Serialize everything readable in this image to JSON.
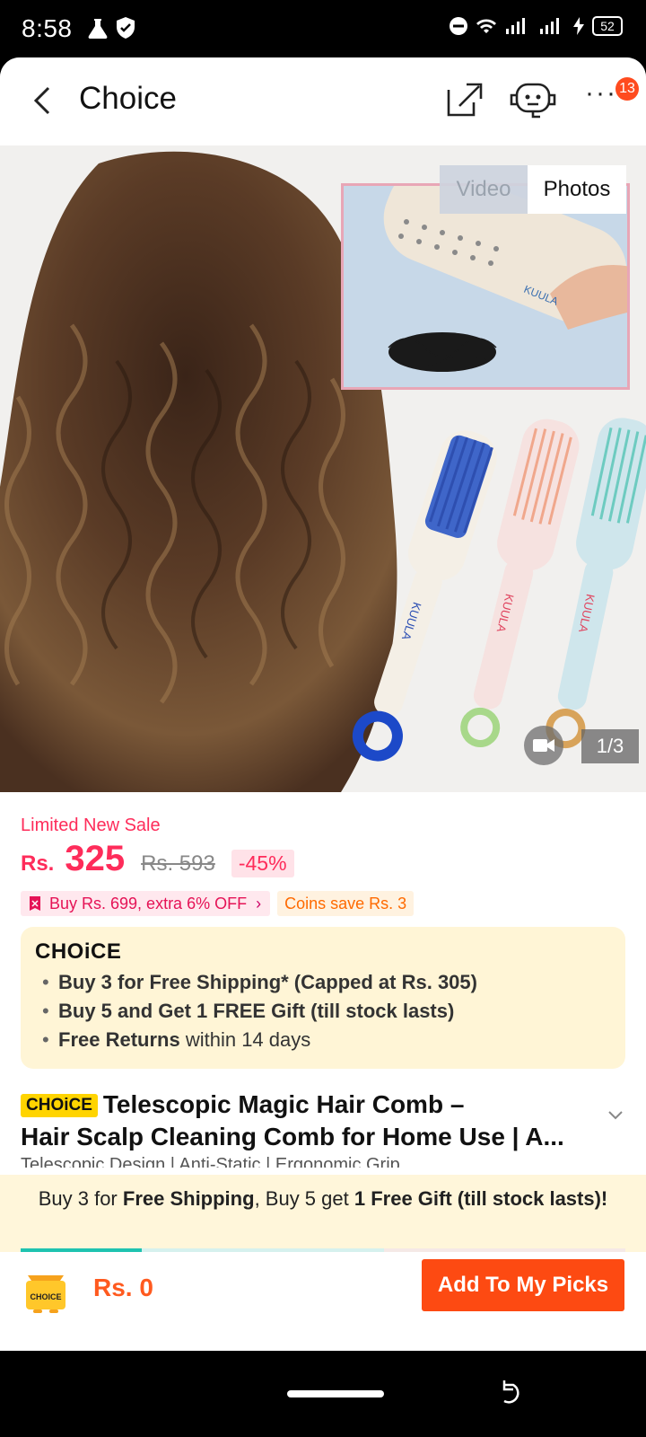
{
  "status_bar": {
    "time": "8:58",
    "battery": "52"
  },
  "header": {
    "title": "Choice",
    "notification_count": "13"
  },
  "gallery": {
    "tabs": [
      "Video",
      "Photos"
    ],
    "selected_tab": "Photos",
    "counter": "1/3",
    "brand_text": "KUULA"
  },
  "price": {
    "sale_label": "Limited New Sale",
    "currency": "Rs.",
    "current": "325",
    "original": "Rs. 593",
    "discount": "-45%"
  },
  "promos": {
    "coupon": "Buy Rs. 699, extra 6% OFF",
    "coins": "Coins save Rs. 3"
  },
  "choice_box": {
    "logo": "CHOiCE",
    "items": [
      {
        "bold": "Buy 3 for  Free Shipping* (Capped at Rs. 305)",
        "rest": ""
      },
      {
        "bold": "Buy 5 and Get 1 FREE Gift (till stock lasts)",
        "rest": ""
      },
      {
        "bold": "Free Returns",
        "rest": " within 14 days"
      }
    ]
  },
  "product": {
    "tag": "CHOiCE",
    "title_line1": "Telescopic Magic Hair Comb –",
    "title_line2": "Hair Scalp Cleaning Comb for Home Use | A...",
    "attributes": "Telescopic Design | Anti-Static | Ergonomic Grip"
  },
  "shipping_banner": {
    "p1": "Buy 3 for ",
    "b1": "Free Shipping",
    "p2": ", Buy 5 get ",
    "b2": "1 Free Gift (till stock lasts)!",
    "progress": 0.2
  },
  "bottom_bar": {
    "cart_label": "CHOICE",
    "amount": "Rs. 0",
    "add_button": "Add To My Picks"
  },
  "colors": {
    "accent_orange": "#fd4a12",
    "sale_red": "#fe2c5a",
    "choice_yellow": "#ffd400",
    "progress_teal": "#1ec3b0"
  }
}
